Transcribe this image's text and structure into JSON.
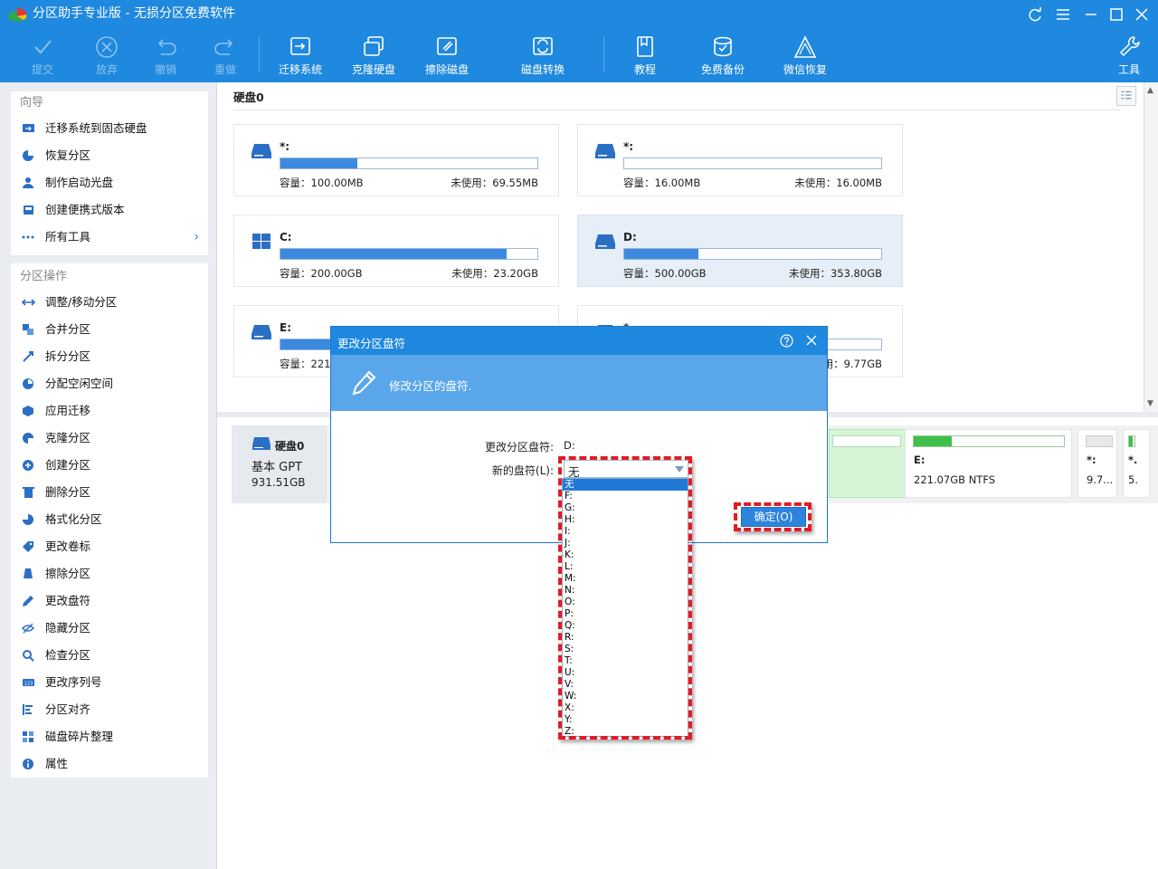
{
  "app": {
    "title": "分区助手专业版 - 无损分区免费软件"
  },
  "toolbar": {
    "commit": "提交",
    "discard": "放弃",
    "undo": "撤销",
    "redo": "重做",
    "migrate_os": "迁移系统",
    "clone_disk": "克隆硬盘",
    "wipe_disk": "擦除磁盘",
    "disk_convert": "磁盘转换",
    "tutorial": "教程",
    "free_backup": "免费备份",
    "wechat_recovery": "微信恢复",
    "tools": "工具"
  },
  "sidebar": {
    "wizard": {
      "title": "向导",
      "items": [
        "迁移系统到固态硬盘",
        "恢复分区",
        "制作启动光盘",
        "创建便携式版本",
        "所有工具"
      ]
    },
    "operations": {
      "title": "分区操作",
      "items": [
        "调整/移动分区",
        "合并分区",
        "拆分分区",
        "分配空闲空间",
        "应用迁移",
        "克隆分区",
        "创建分区",
        "删除分区",
        "格式化分区",
        "更改卷标",
        "擦除分区",
        "更改盘符",
        "隐藏分区",
        "检查分区",
        "更改序列号",
        "分区对齐",
        "磁盘碎片整理",
        "属性"
      ]
    }
  },
  "main": {
    "disk_label": "硬盘0",
    "partitions": [
      {
        "name": "*:",
        "capacity": "容量：100.00MB",
        "unused": "未使用：69.55MB",
        "usage": 0.3
      },
      {
        "name": "*:",
        "capacity": "容量：16.00MB",
        "unused": "未使用：16.00MB",
        "usage": 0.0
      },
      {
        "name": "C:",
        "capacity": "容量：200.00GB",
        "unused": "未使用：23.20GB",
        "usage": 0.88
      },
      {
        "name": "D:",
        "capacity": "容量：500.00GB",
        "unused": "未使用：353.80GB",
        "usage": 0.29
      },
      {
        "name": "E:",
        "capacity": "容量：221.",
        "unused": "",
        "usage": 0.2
      },
      {
        "name": "*",
        "capacity": "",
        "unused": "未使用：9.77GB",
        "usage": 0.0
      }
    ]
  },
  "bottom": {
    "disk_name": "硬盘0",
    "disk_type": "基本 GPT",
    "disk_size": "931.51GB",
    "parts": [
      {
        "name": "E:",
        "info": "221.07GB NTFS",
        "usage": 0.25
      },
      {
        "name": "*:",
        "info": "9.7...",
        "usage": 0.0
      },
      {
        "name": "*.",
        "info": "5.",
        "usage": 0.3
      }
    ]
  },
  "dialog": {
    "title": "更改分区盘符",
    "banner_text": "修改分区的盘符.",
    "current_label": "更改分区盘符:",
    "current_value": "D:",
    "new_label": "新的盘符(L):",
    "selected": "无",
    "ok_button": "确定(O)",
    "options": [
      "无",
      "F:",
      "G:",
      "H:",
      "I:",
      "J:",
      "K:",
      "L:",
      "M:",
      "N:",
      "O:",
      "P:",
      "Q:",
      "R:",
      "S:",
      "T:",
      "U:",
      "V:",
      "W:",
      "X:",
      "Y:",
      "Z:"
    ]
  },
  "icons": {
    "app_logo": "pie-chart-icon",
    "refresh": "refresh-icon",
    "menu": "menu-icon",
    "minimize": "minimize-icon",
    "maximize": "maximize-icon",
    "close": "close-icon",
    "help": "help-icon",
    "pencil": "pencil-icon"
  },
  "colors": {
    "accent": "#1f88df",
    "highlight": "#e21b25",
    "usage_bar": "#3c8ae0",
    "green": "#3fbf4a"
  }
}
